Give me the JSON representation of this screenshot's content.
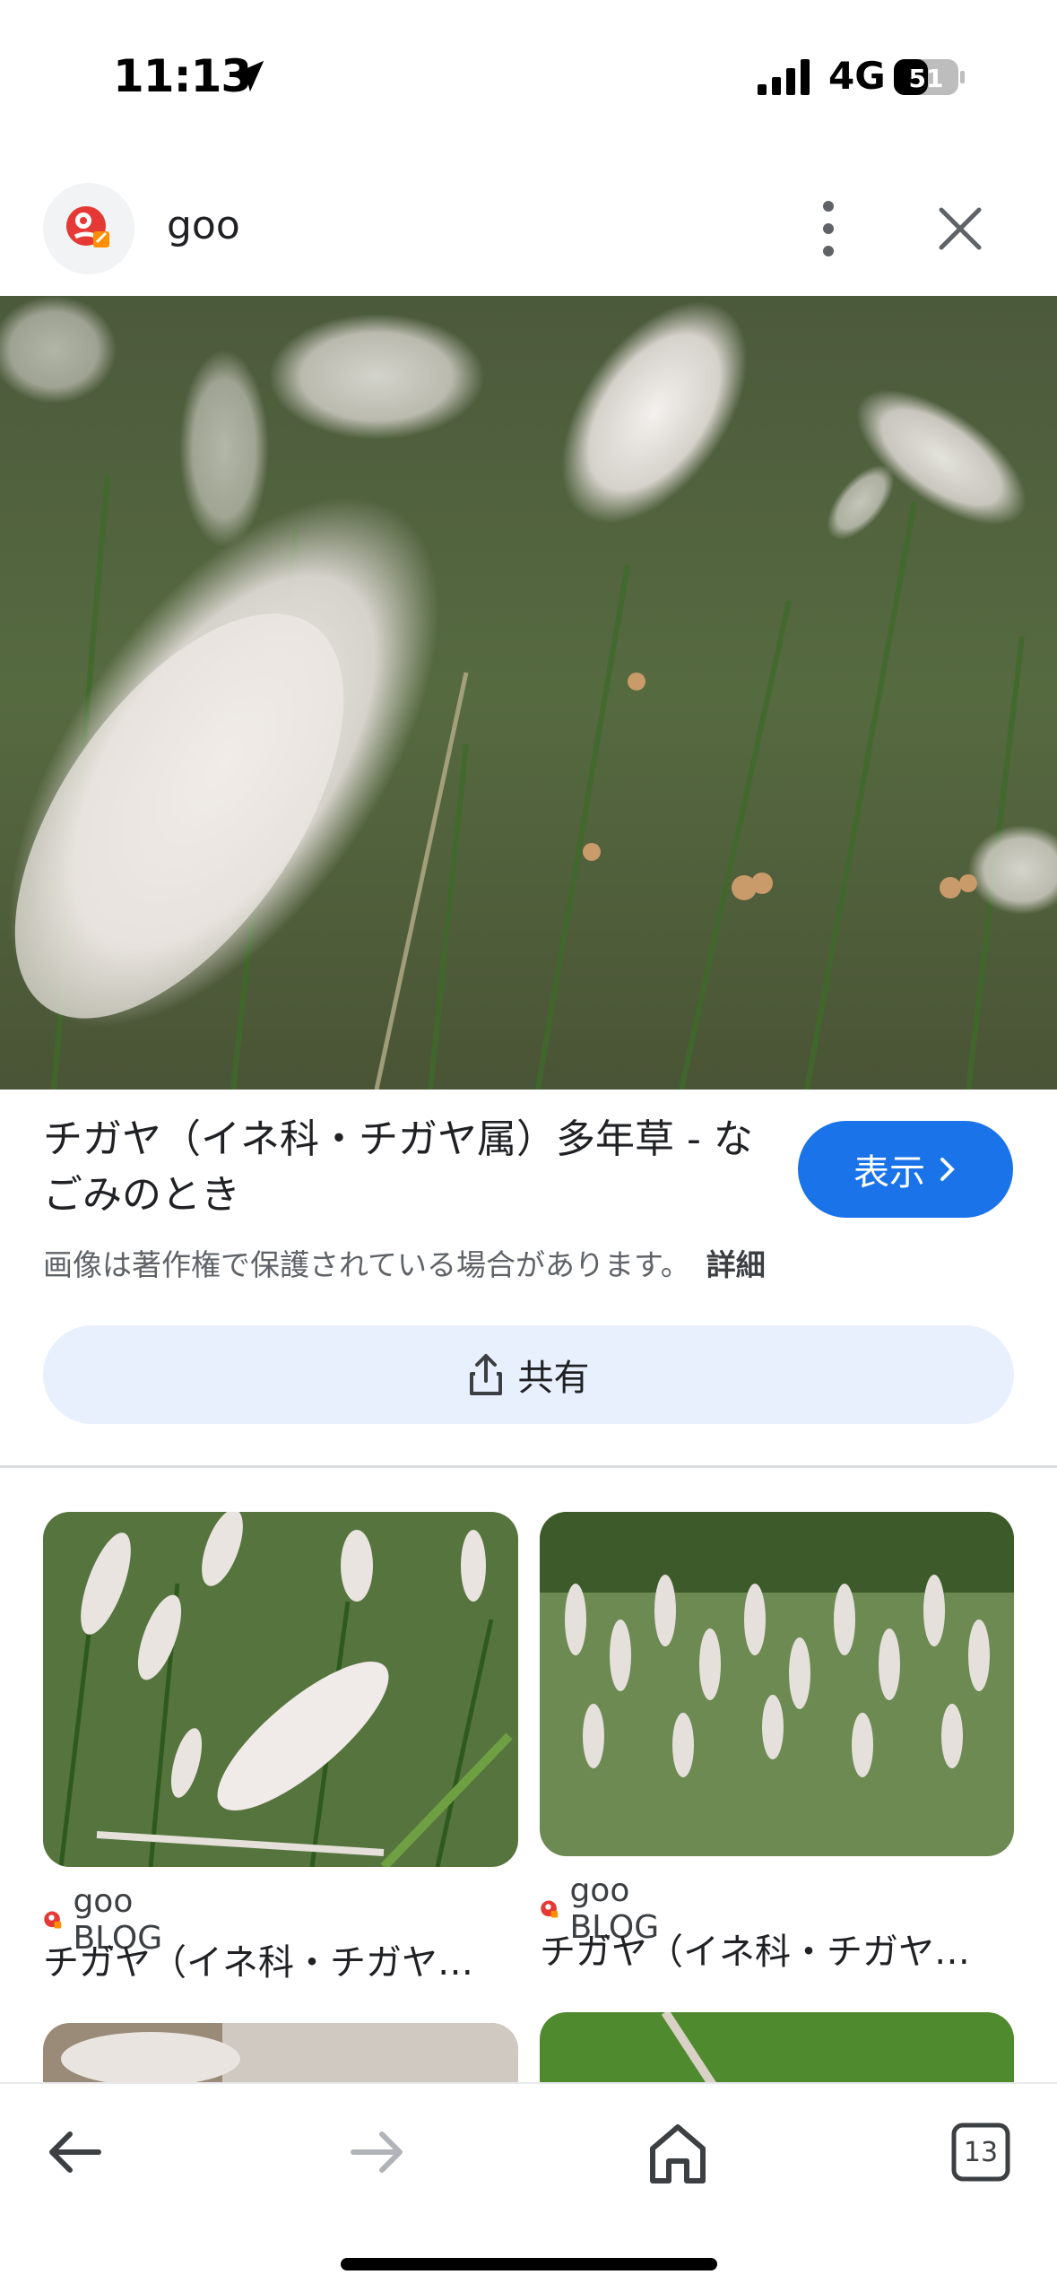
{
  "status_bar": {
    "time": "11:13",
    "network": "4G",
    "battery_level": "51"
  },
  "header": {
    "site_name": "goo"
  },
  "result": {
    "title": "チガヤ（イネ科・チガヤ属）多年草 - なごみのとき",
    "view_button": "表示",
    "copyright": "画像は著作権で保護されている場合があります。",
    "details_link": "詳細",
    "share_button": "共有"
  },
  "related": [
    {
      "source": "goo BLOG",
      "title": "チガヤ（イネ科・チガヤ…"
    },
    {
      "source": "goo BLOG",
      "title": "チガヤ（イネ科・チガヤ…"
    }
  ],
  "toolbar": {
    "tab_count": "13"
  },
  "colors": {
    "accent": "#1a73e8",
    "share_bg": "#e8f0fe",
    "logo_red": "#e53935"
  }
}
